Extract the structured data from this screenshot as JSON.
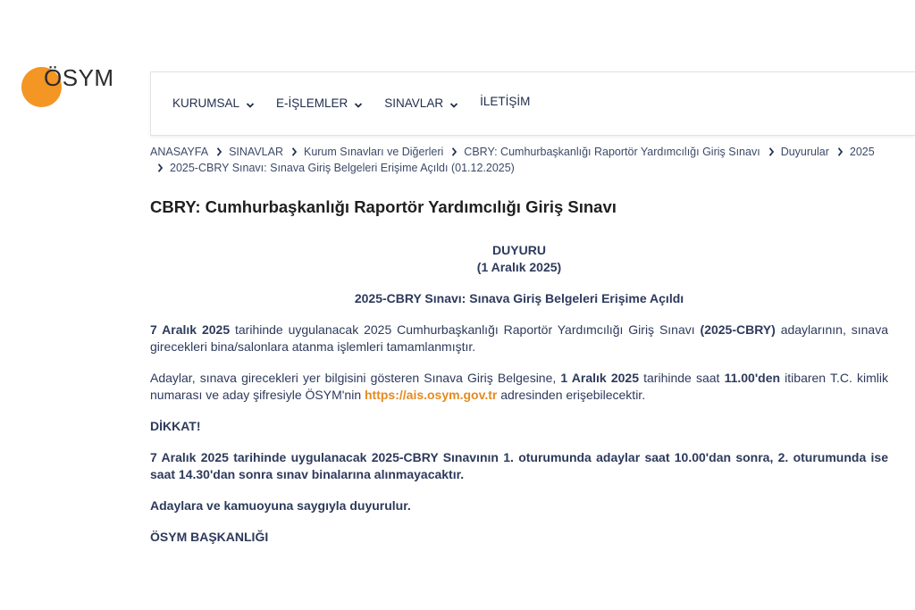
{
  "logo": {
    "text": "ÖSYM",
    "circle_color": "#f39623"
  },
  "nav": {
    "items": [
      {
        "label": "KURUMSAL",
        "icon": "chevron-down-icon"
      },
      {
        "label": "E-İŞLEMLER",
        "icon": "chevron-down-icon"
      },
      {
        "label": "SINAVLAR",
        "icon": "chevron-down-icon"
      },
      {
        "label": "İLETİŞİM"
      }
    ]
  },
  "breadcrumb": {
    "items": [
      "ANASAYFA",
      "SINAVLAR",
      "Kurum Sınavları ve Diğerleri",
      "CBRY: Cumhurbaşkanlığı Raportör Yardımcılığı Giriş Sınavı",
      "Duyurular",
      "2025",
      "2025-CBRY Sınavı: Sınava Giriş Belgeleri Erişime Açıldı (01.12.2025)"
    ]
  },
  "page_title": "CBRY: Cumhurbaşkanlığı Raportör Yardımcılığı Giriş Sınavı",
  "announcement": {
    "heading": "DUYURU",
    "date": "(1 Aralık 2025)",
    "subject": "2025-CBRY Sınavı: Sınava Giriş Belgeleri Erişime Açıldı",
    "p1_date": "7 Aralık 2025",
    "p1_text1": " tarihinde uygulanacak 2025 Cumhurbaşkanlığı Raportör Yardımcılığı Giriş Sınavı ",
    "p1_code": "(2025-CBRY)",
    "p1_text2": " adaylarının, sınava girecekleri bina/salonlara atanma işlemleri tamamlanmıştır.",
    "p2_text1": "Adaylar, sınava girecekleri yer bilgisini gösteren Sınava Giriş Belgesine, ",
    "p2_date": "1 Aralık 2025",
    "p2_text2": " tarihinde saat ",
    "p2_time": "11.00'den",
    "p2_text3": " itibaren T.C. kimlik numarası ve aday şifresiyle ÖSYM'nin ",
    "p2_link": "https://ais.osym.gov.tr",
    "p2_text4": " adresinden erişebilecektir.",
    "warning": "DİKKAT!",
    "p3": "7 Aralık 2025 tarihinde uygulanacak 2025-CBRY Sınavının 1. oturumunda adaylar saat 10.00'dan sonra, 2. oturumunda ise saat 14.30'dan sonra sınav binalarına alınmayacaktır.",
    "p4": "Adaylara ve kamuoyuna saygıyla duyurulur.",
    "signature": "ÖSYM BAŞKANLIĞI"
  },
  "colors": {
    "accent": "#e58a1f",
    "text": "#2e3a5c"
  }
}
